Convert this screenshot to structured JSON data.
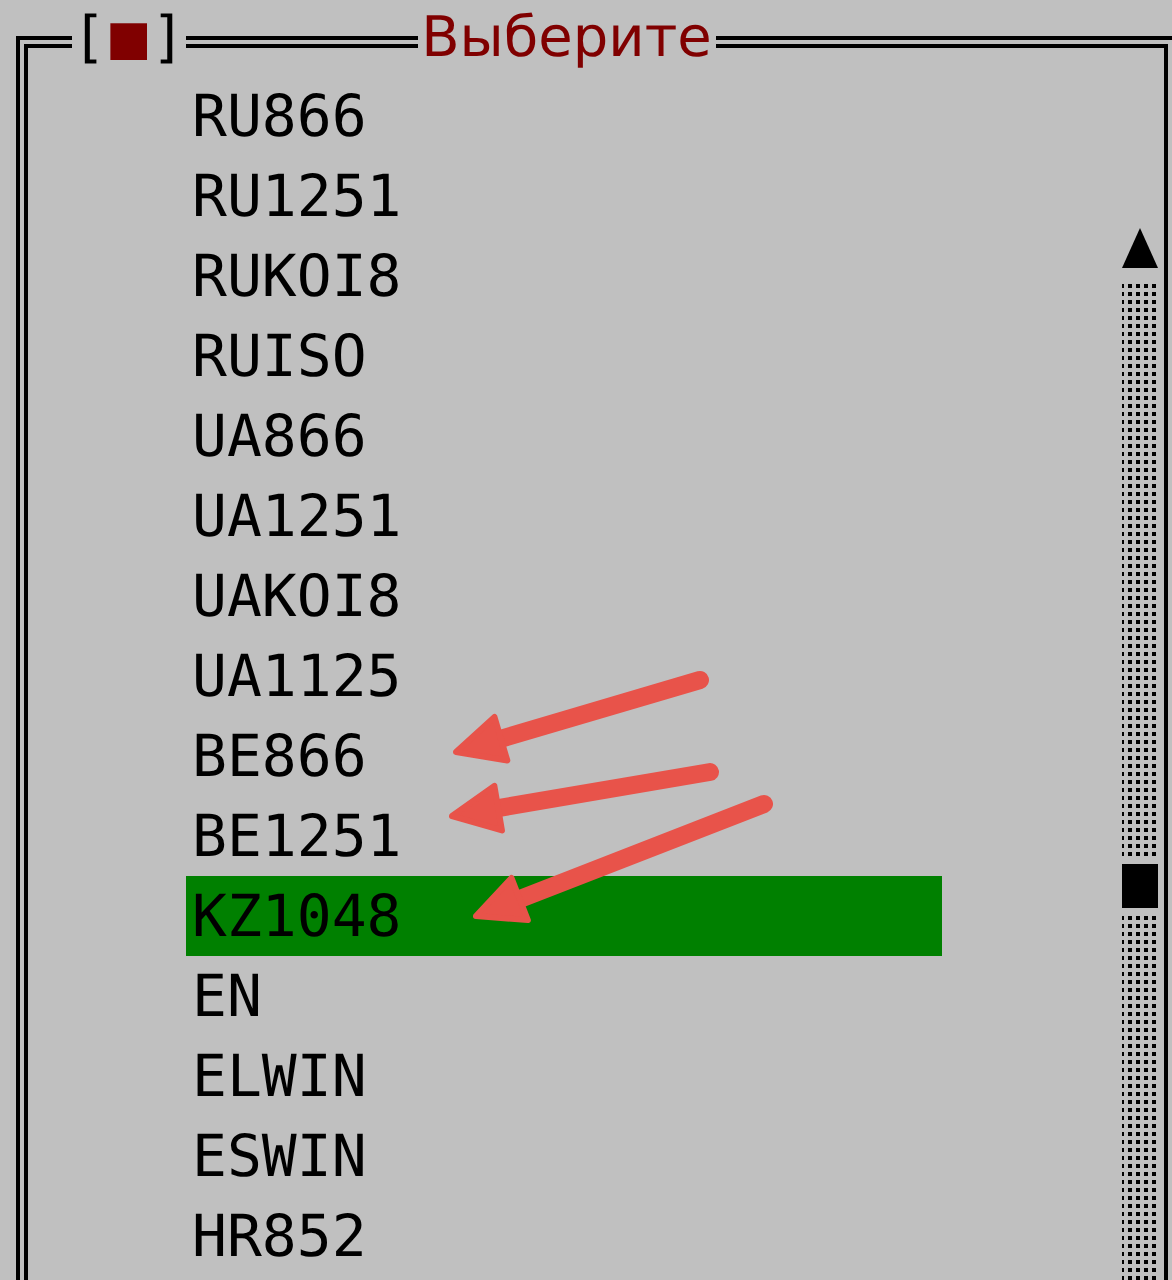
{
  "window": {
    "title": "Выберите",
    "close_button": {
      "left": "[",
      "icon": "■",
      "right": "]"
    }
  },
  "items": [
    {
      "label": "RU866",
      "selected": false
    },
    {
      "label": "RU1251",
      "selected": false
    },
    {
      "label": "RUKOI8",
      "selected": false
    },
    {
      "label": "RUISO",
      "selected": false
    },
    {
      "label": "UA866",
      "selected": false
    },
    {
      "label": "UA1251",
      "selected": false
    },
    {
      "label": "UAKOI8",
      "selected": false
    },
    {
      "label": "UA1125",
      "selected": false
    },
    {
      "label": "BE866",
      "selected": false
    },
    {
      "label": "BE1251",
      "selected": false
    },
    {
      "label": "KZ1048",
      "selected": true
    },
    {
      "label": "EN",
      "selected": false
    },
    {
      "label": "ELWIN",
      "selected": false
    },
    {
      "label": "ESWIN",
      "selected": false
    },
    {
      "label": "HR852",
      "selected": false
    }
  ]
}
